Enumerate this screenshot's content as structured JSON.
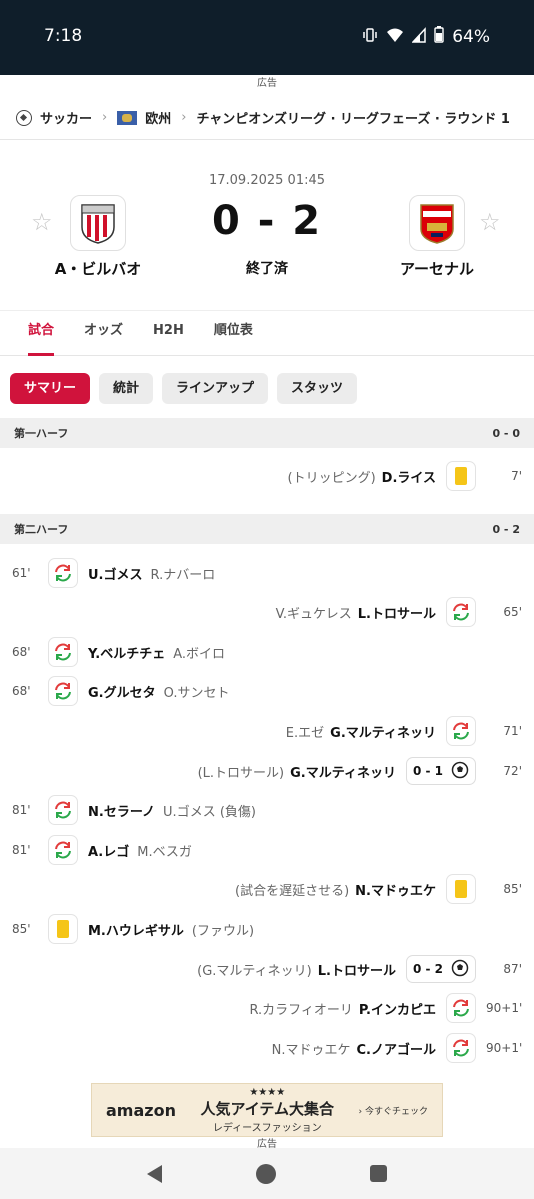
{
  "status_bar": {
    "time": "7:18",
    "battery": "64%"
  },
  "ad_label": "広告",
  "breadcrumb": {
    "sport": "サッカー",
    "region": "欧州",
    "competition": "チャンピオンズリーグ · リーグフェーズ · ラウンド 1"
  },
  "match": {
    "datetime": "17.09.2025 01:45",
    "home_team": "A・ビルバオ",
    "away_team": "アーセナル",
    "score": "0 - 2",
    "status": "終了済"
  },
  "tabs": [
    "試合",
    "オッズ",
    "H2H",
    "順位表"
  ],
  "pills": [
    "サマリー",
    "統計",
    "ラインアップ",
    "スタッツ"
  ],
  "sections": [
    {
      "label": "第一ハーフ",
      "score": "0 - 0"
    },
    {
      "label": "第二ハーフ",
      "score": "0 - 2"
    }
  ],
  "events": [
    {
      "side": "away",
      "type": "yellow",
      "minute": "7'",
      "player": "D.ライス",
      "detail": "(トリッピング)"
    },
    {
      "side": "home",
      "type": "sub",
      "minute": "61'",
      "player": "U.ゴメス",
      "detail": "R.ナバーロ"
    },
    {
      "side": "away",
      "type": "sub",
      "minute": "65'",
      "player": "L.トロサール",
      "detail": "V.ギュケレス"
    },
    {
      "side": "home",
      "type": "sub",
      "minute": "68'",
      "player": "Y.ベルチチェ",
      "detail": "A.ボイロ"
    },
    {
      "side": "home",
      "type": "sub",
      "minute": "68'",
      "player": "G.グルセタ",
      "detail": "O.サンセト"
    },
    {
      "side": "away",
      "type": "sub",
      "minute": "71'",
      "player": "G.マルティネッリ",
      "detail": "E.エゼ"
    },
    {
      "side": "away",
      "type": "goal",
      "minute": "72'",
      "player": "G.マルティネッリ",
      "detail": "(L.トロサール)",
      "score": "0 - 1"
    },
    {
      "side": "home",
      "type": "sub",
      "minute": "81'",
      "player": "N.セラーノ",
      "detail": "U.ゴメス (負傷)"
    },
    {
      "side": "home",
      "type": "sub",
      "minute": "81'",
      "player": "A.レゴ",
      "detail": "M.ベスガ"
    },
    {
      "side": "away",
      "type": "yellow",
      "minute": "85'",
      "player": "N.マドゥエケ",
      "detail": "(試合を遅延させる)"
    },
    {
      "side": "home",
      "type": "yellow",
      "minute": "85'",
      "player": "M.ハウレギサル",
      "detail": "(ファウル)"
    },
    {
      "side": "away",
      "type": "goal",
      "minute": "87'",
      "player": "L.トロサール",
      "detail": "(G.マルティネッリ)",
      "score": "0 - 2"
    },
    {
      "side": "away",
      "type": "sub",
      "minute": "90+1'",
      "player": "P.インカピエ",
      "detail": "R.カラフィオーリ"
    },
    {
      "side": "away",
      "type": "sub",
      "minute": "90+1'",
      "player": "C.ノアゴール",
      "detail": "N.マドゥエケ"
    }
  ],
  "ad": {
    "brand": "amazon",
    "stars": "★★★★",
    "headline": "人気アイテム大集合",
    "sub": "レディースファッション",
    "cta": "› 今すぐチェック"
  },
  "colors": {
    "accent": "#d0133c",
    "status_bar": "#0f1e2a",
    "yellow_card": "#f5c518",
    "sub_in": "#2aa84a",
    "sub_out": "#e23b3b"
  }
}
